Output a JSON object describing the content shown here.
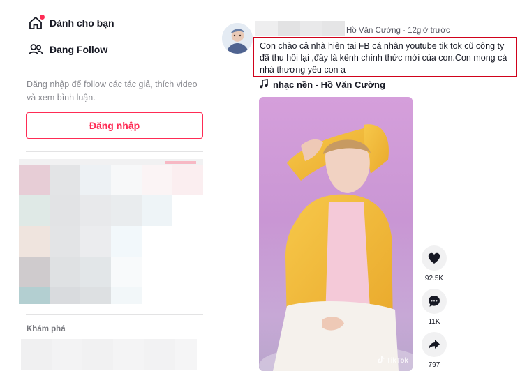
{
  "sidebar": {
    "for_you_label": "Dành cho bạn",
    "following_label": "Đang Follow",
    "login_hint": "Đăng nhập để follow các tác giả, thích video và xem bình luận.",
    "login_button": "Đăng nhập",
    "discover_label": "Khám phá"
  },
  "post": {
    "author_meta": "Hồ Văn Cường · 12giờ trước",
    "caption": "Con chào cả nhà hiện tai FB cá nhân youtube tik tok cũ công ty đã thu hồi lại ,đây là kênh chính thức mới của con.Con mong cả nhà thương yêu con ạ",
    "music": "nhạc nền - Hồ Văn Cường",
    "watermark": "TikTok"
  },
  "actions": {
    "likes": "92.5K",
    "comments": "11K",
    "shares": "797"
  },
  "colors": {
    "accent": "#fe2c55",
    "highlight_border": "#d0021b"
  }
}
